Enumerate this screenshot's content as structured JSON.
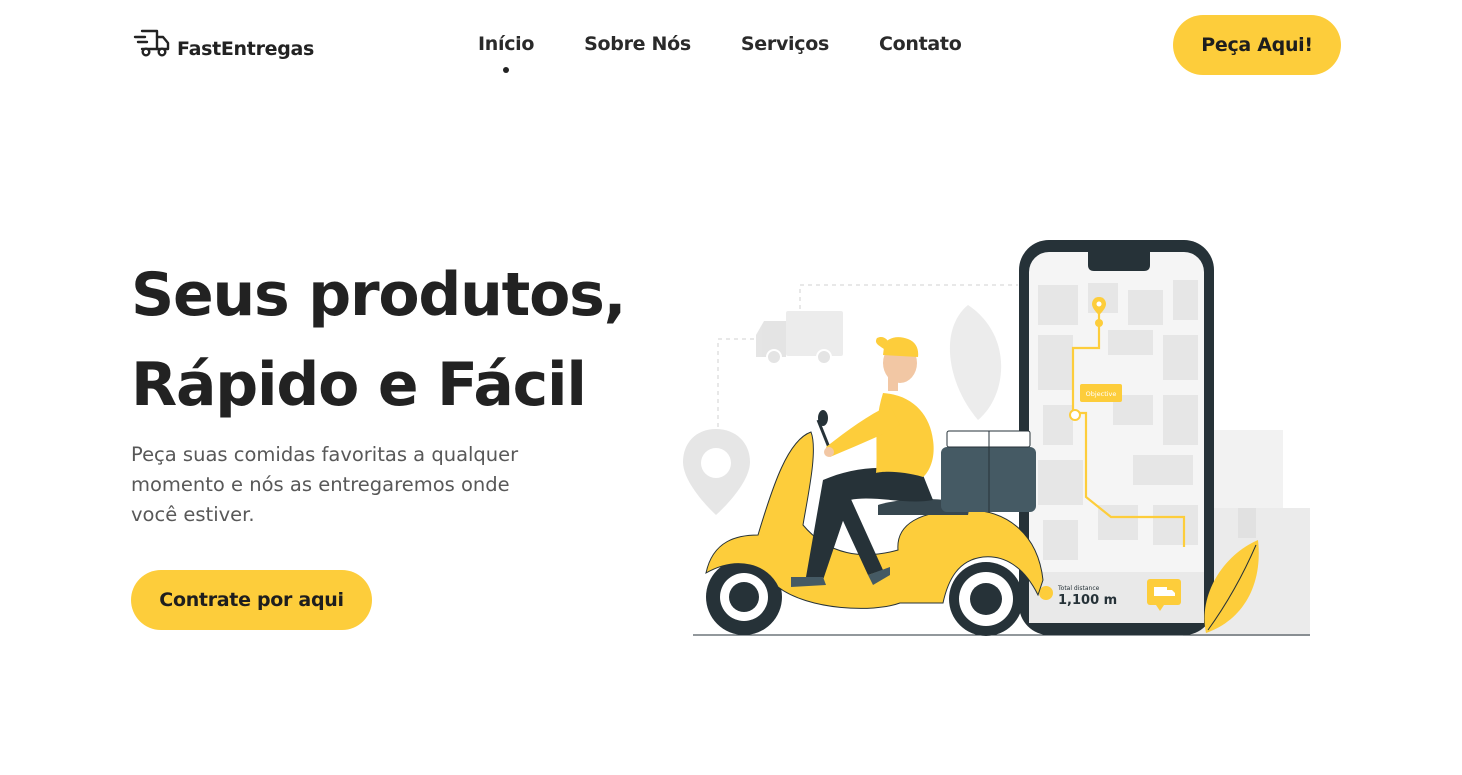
{
  "brand": {
    "name": "FastEntregas",
    "logo_icon": "delivery-truck-icon"
  },
  "nav": {
    "items": [
      {
        "label": "Início",
        "active": true
      },
      {
        "label": "Sobre Nós",
        "active": false
      },
      {
        "label": "Serviços",
        "active": false
      },
      {
        "label": "Contato",
        "active": false
      }
    ],
    "cta_label": "Peça Aqui!"
  },
  "hero": {
    "title_line1": "Seus produtos,",
    "title_line2": "Rápido e Fácil",
    "subtitle": "Peça suas comidas favoritas a qualquer momento e nós as entregaremos onde você estiver.",
    "cta_label": "Contrate por aqui"
  },
  "illustration": {
    "map_pin_label": "Objective",
    "distance_label": "Total distance",
    "distance_value": "1,100 m"
  },
  "colors": {
    "accent": "#fdcd3b",
    "dark": "#263238",
    "text": "#222222",
    "muted": "#585858"
  }
}
